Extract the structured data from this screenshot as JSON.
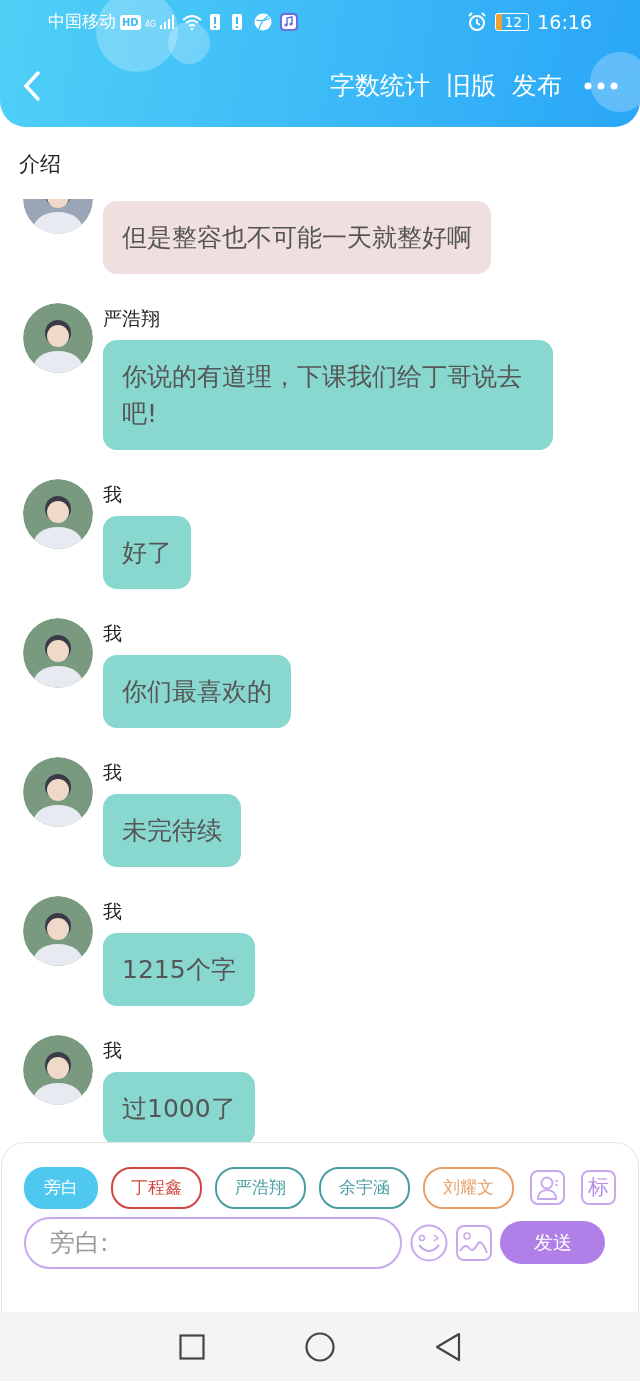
{
  "status_bar": {
    "carrier": "中国移动",
    "hd": "HD",
    "network": "4G",
    "battery": "12",
    "time": "16:16"
  },
  "header": {
    "actions": [
      "字数统计",
      "旧版",
      "发布"
    ]
  },
  "section_title": "介绍",
  "messages": [
    {
      "text": "但是整容也不可能一天就整好啊",
      "color": "#f0dfdf"
    },
    {
      "sender": "严浩翔",
      "text": "你说的有道理，下课我们给丁哥说去吧!",
      "color": "#88d8cf"
    },
    {
      "sender": "我",
      "text": "好了",
      "color": "#88d8cf"
    },
    {
      "sender": "我",
      "text": "你们最喜欢的",
      "color": "#88d8cf"
    },
    {
      "sender": "我",
      "text": "未完待续",
      "color": "#88d8cf"
    },
    {
      "sender": "我",
      "text": "1215个字",
      "color": "#88d8cf"
    },
    {
      "sender": "我",
      "text": "过1000了",
      "color": "#88d8cf"
    }
  ],
  "roles": [
    {
      "label": "旁白",
      "selected": true,
      "color": "#4fc8ef"
    },
    {
      "label": "丁程鑫",
      "selected": false,
      "color": "#d2453f"
    },
    {
      "label": "严浩翔",
      "selected": false,
      "color": "#4a9ea3"
    },
    {
      "label": "余宇涵",
      "selected": false,
      "color": "#4a9ea3"
    },
    {
      "label": "刘耀文",
      "selected": false,
      "color": "#e8a06a"
    }
  ],
  "tag_button": "标",
  "input": {
    "placeholder": "旁白:"
  },
  "send_button": "发送"
}
